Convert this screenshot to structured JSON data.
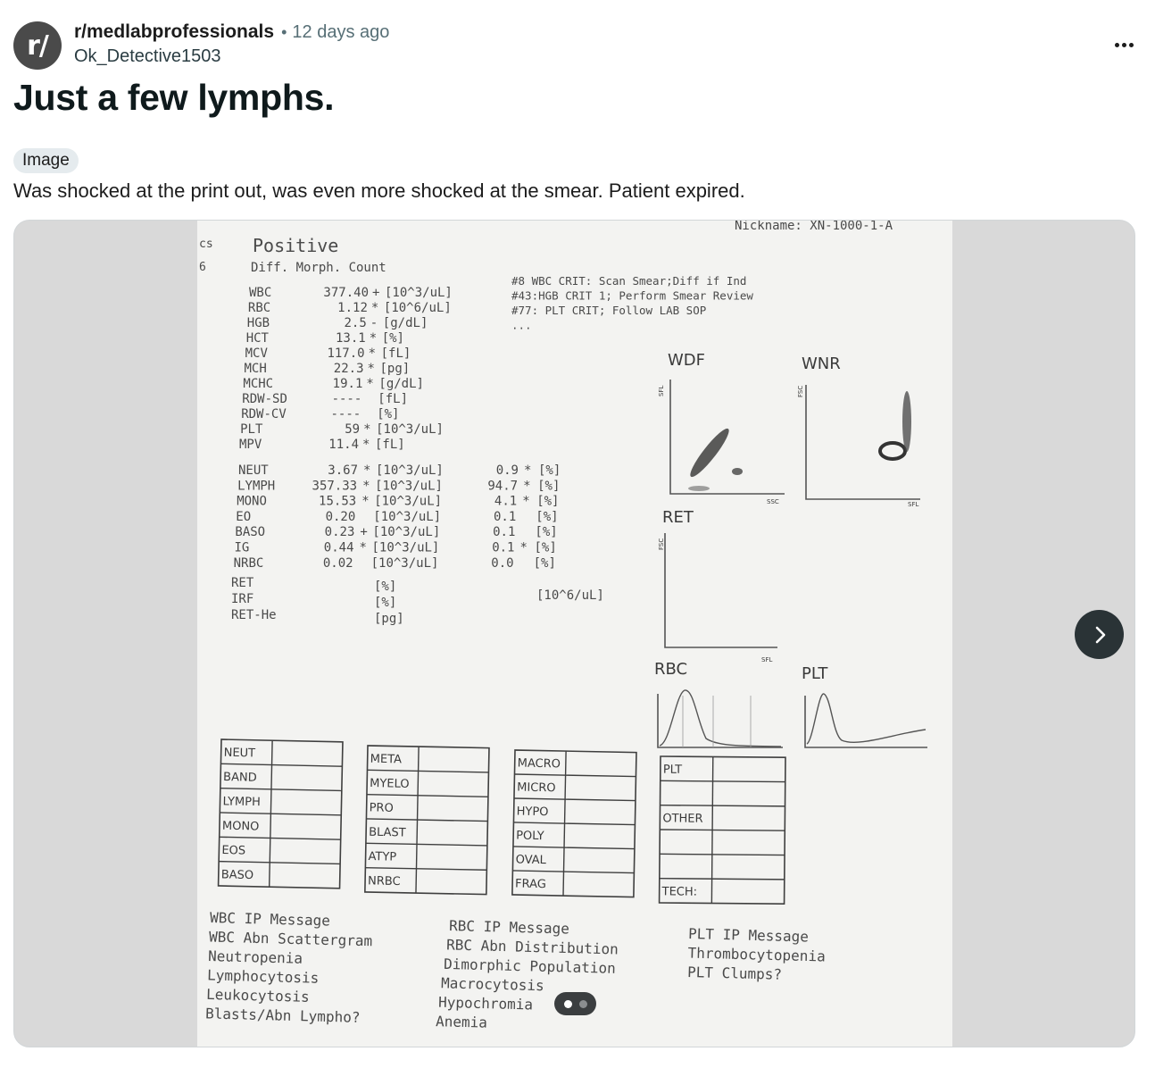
{
  "post": {
    "avatar_text": "r/",
    "subreddit": "r/medlabprofessionals",
    "separator": "•",
    "time_ago": "12 days ago",
    "author": "Ok_Detective1503",
    "title": "Just a few lymphs.",
    "flair": "Image",
    "body": "Was shocked at the print out, was even more shocked at the smear. Patient expired."
  },
  "icons": {
    "overflow": "more-horizontal-icon",
    "next": "chevron-right-icon"
  },
  "gallery": {
    "current_page": 1,
    "total_pages": 2
  },
  "printout": {
    "nickname_label": "Nickname:",
    "nickname_value": "XN-1000-1-A",
    "edge_top": "cs",
    "edge_bottom": "6",
    "status": "Positive",
    "status_sub": "Diff.  Morph.  Count",
    "messages": [
      "#8 WBC CRIT: Scan Smear;Diff if Ind",
      "#43:HGB CRIT 1; Perform Smear Review",
      "#77: PLT CRIT; Follow LAB SOP",
      "..."
    ],
    "cbc": [
      {
        "name": "WBC",
        "value": "377.40",
        "flag": "+",
        "unit": "[10^3/uL]"
      },
      {
        "name": "RBC",
        "value": "1.12",
        "flag": "*",
        "unit": "[10^6/uL]"
      },
      {
        "name": "HGB",
        "value": "2.5",
        "flag": "-",
        "unit": "[g/dL]"
      },
      {
        "name": "HCT",
        "value": "13.1",
        "flag": "*",
        "unit": "[%]"
      },
      {
        "name": "MCV",
        "value": "117.0",
        "flag": "*",
        "unit": "[fL]"
      },
      {
        "name": "MCH",
        "value": "22.3",
        "flag": "*",
        "unit": "[pg]"
      },
      {
        "name": "MCHC",
        "value": "19.1",
        "flag": "*",
        "unit": "[g/dL]"
      },
      {
        "name": "RDW-SD",
        "value": "----",
        "flag": "",
        "unit": "[fL]"
      },
      {
        "name": "RDW-CV",
        "value": "----",
        "flag": "",
        "unit": "[%]"
      },
      {
        "name": "PLT",
        "value": "59",
        "flag": "*",
        "unit": "[10^3/uL]"
      },
      {
        "name": "MPV",
        "value": "11.4",
        "flag": "*",
        "unit": "[fL]"
      }
    ],
    "diff": [
      {
        "name": "NEUT",
        "abs": "3.67",
        "aflag": "*",
        "unit": "[10^3/uL]",
        "pct": "0.9",
        "pflag": "*",
        "punit": "[%]"
      },
      {
        "name": "LYMPH",
        "abs": "357.33",
        "aflag": "*",
        "unit": "[10^3/uL]",
        "pct": "94.7",
        "pflag": "*",
        "punit": "[%]"
      },
      {
        "name": "MONO",
        "abs": "15.53",
        "aflag": "*",
        "unit": "[10^3/uL]",
        "pct": "4.1",
        "pflag": "*",
        "punit": "[%]"
      },
      {
        "name": "EO",
        "abs": "0.20",
        "aflag": "",
        "unit": "[10^3/uL]",
        "pct": "0.1",
        "pflag": "",
        "punit": "[%]"
      },
      {
        "name": "BASO",
        "abs": "0.23",
        "aflag": "+",
        "unit": "[10^3/uL]",
        "pct": "0.1",
        "pflag": "",
        "punit": "[%]"
      },
      {
        "name": "IG",
        "abs": "0.44",
        "aflag": "*",
        "unit": "[10^3/uL]",
        "pct": "0.1",
        "pflag": "*",
        "punit": "[%]"
      },
      {
        "name": "NRBC",
        "abs": "0.02",
        "aflag": "",
        "unit": "[10^3/uL]",
        "pct": "0.0",
        "pflag": "",
        "punit": "[%]"
      }
    ],
    "ret": [
      {
        "name": "RET",
        "unit": "[%]"
      },
      {
        "name": "IRF",
        "unit": "[%]"
      },
      {
        "name": "RET-He",
        "unit": "[pg]"
      }
    ],
    "ret_abs_unit": "[10^6/uL]",
    "scatter": {
      "wdf": {
        "title": "WDF",
        "y": "SFL",
        "x": "SSC"
      },
      "wnr": {
        "title": "WNR",
        "y": "FSC",
        "x": "SFL"
      },
      "ret": {
        "title": "RET",
        "y": "FSC",
        "x": "SFL"
      },
      "rbc": {
        "title": "RBC"
      },
      "plt": {
        "title": "PLT"
      }
    },
    "tables": {
      "white": [
        "NEUT",
        "BAND",
        "LYMPH",
        "MONO",
        "EOS",
        "BASO"
      ],
      "immature": [
        "META",
        "MYELO",
        "PRO",
        "BLAST",
        "ATYP",
        "NRBC"
      ],
      "morph": [
        "MACRO",
        "MICRO",
        "HYPO",
        "POLY",
        "OVAL",
        "FRAG"
      ],
      "plt": [
        "PLT",
        "",
        "OTHER",
        "",
        "",
        "TECH:"
      ]
    },
    "ip_messages": {
      "wbc": [
        "WBC IP Message",
        "WBC Abn Scattergram",
        "Neutropenia",
        "Lymphocytosis",
        "Leukocytosis",
        "Blasts/Abn Lympho?"
      ],
      "rbc": [
        "RBC IP Message",
        "RBC Abn Distribution",
        "Dimorphic Population",
        "Macrocytosis",
        "Hypochromia",
        "Anemia"
      ],
      "plt": [
        "PLT IP Message",
        "Thrombocytopenia",
        "PLT Clumps?"
      ]
    }
  }
}
